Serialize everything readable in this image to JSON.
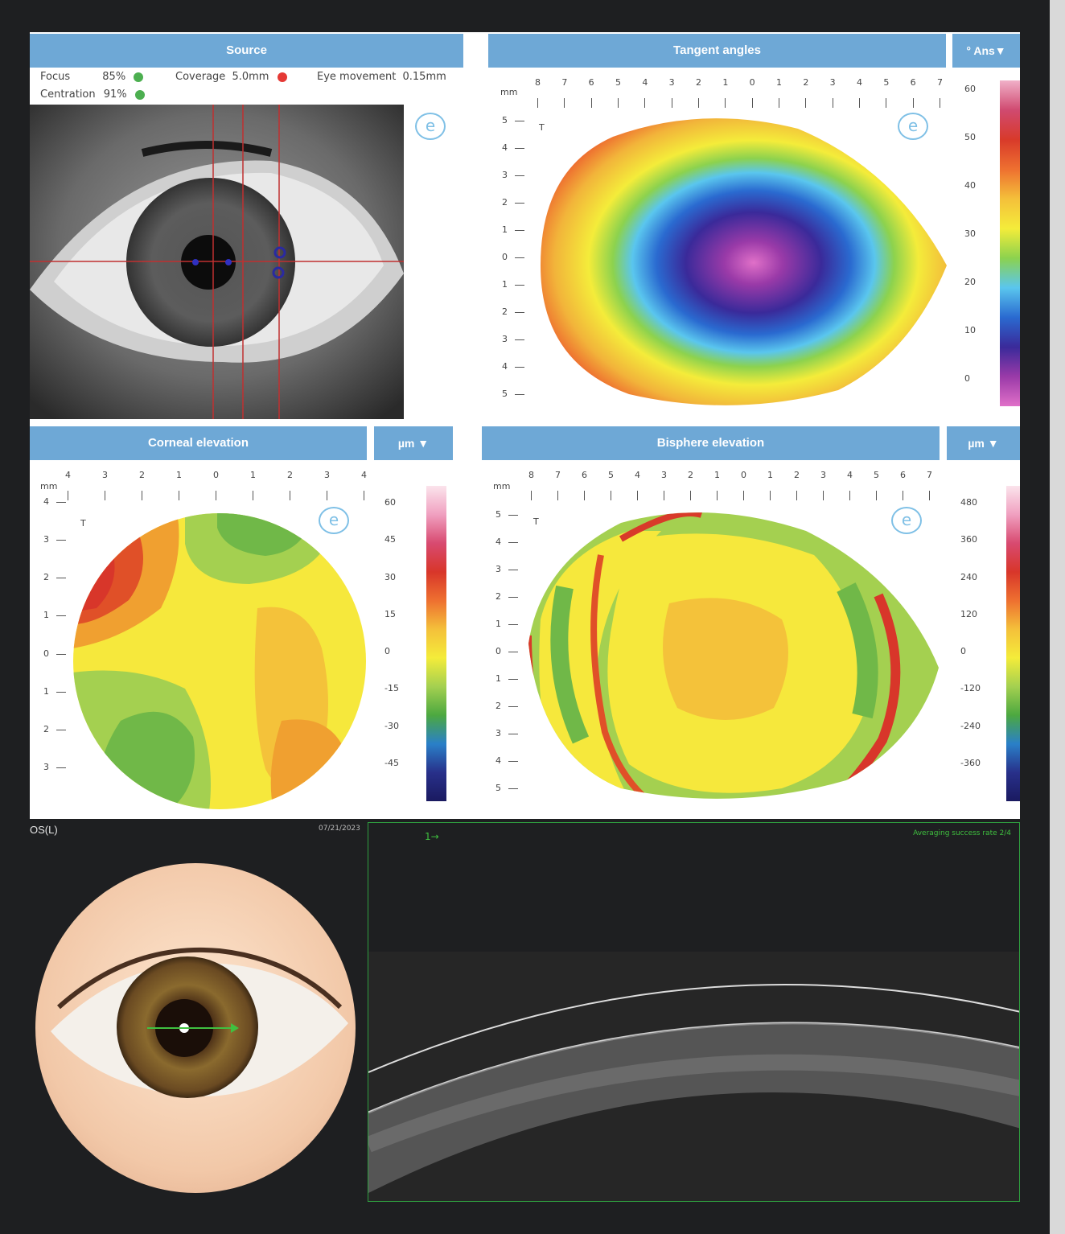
{
  "source": {
    "header": "Source",
    "focus_label": "Focus",
    "focus_value": "85%",
    "centration_label": "Centration",
    "centration_value": "91%",
    "coverage_label": "Coverage",
    "coverage_value": "5.0mm",
    "eye_movement_label": "Eye movement",
    "eye_movement_value": "0.15mm",
    "status_colors": {
      "ok": "#4caf50",
      "bad": "#e53935"
    }
  },
  "tangent": {
    "header": "Tangent angles",
    "dropdown_label": "° Ans",
    "unit": "mm",
    "x_ticks": [
      "8",
      "7",
      "6",
      "5",
      "4",
      "3",
      "2",
      "1",
      "0",
      "1",
      "2",
      "3",
      "4",
      "5",
      "6",
      "7"
    ],
    "y_ticks": [
      "5",
      "4",
      "3",
      "2",
      "1",
      "0",
      "1",
      "2",
      "3",
      "4",
      "5"
    ],
    "scale_ticks": [
      "60",
      "50",
      "40",
      "30",
      "20",
      "10",
      "0"
    ],
    "t_marker": "T"
  },
  "corneal": {
    "header": "Corneal elevation",
    "unit_dropdown": "µm",
    "unit": "mm",
    "x_ticks": [
      "4",
      "3",
      "2",
      "1",
      "0",
      "1",
      "2",
      "3",
      "4"
    ],
    "y_ticks": [
      "4",
      "3",
      "2",
      "1",
      "0",
      "1",
      "2",
      "3"
    ],
    "scale_ticks": [
      "60",
      "45",
      "30",
      "15",
      "0",
      "-15",
      "-30",
      "-45"
    ],
    "t_marker": "T"
  },
  "bisphere": {
    "header": "Bisphere elevation",
    "unit_dropdown": "µm",
    "unit": "mm",
    "x_ticks": [
      "8",
      "7",
      "6",
      "5",
      "4",
      "3",
      "2",
      "1",
      "0",
      "1",
      "2",
      "3",
      "4",
      "5",
      "6",
      "7"
    ],
    "y_ticks": [
      "5",
      "4",
      "3",
      "2",
      "1",
      "0",
      "1",
      "2",
      "3",
      "4",
      "5"
    ],
    "scale_ticks": [
      "480",
      "360",
      "240",
      "120",
      "0",
      "-120",
      "-240",
      "-360"
    ],
    "t_marker": "T"
  },
  "oct": {
    "eye_label": "OS(L)",
    "date": "07/21/2023",
    "scan_marker": "1→",
    "averaging_text": "Averaging success rate 2/4"
  },
  "colors": {
    "header_blue": "#6ea8d6",
    "oct_border": "#2f9e3f"
  }
}
